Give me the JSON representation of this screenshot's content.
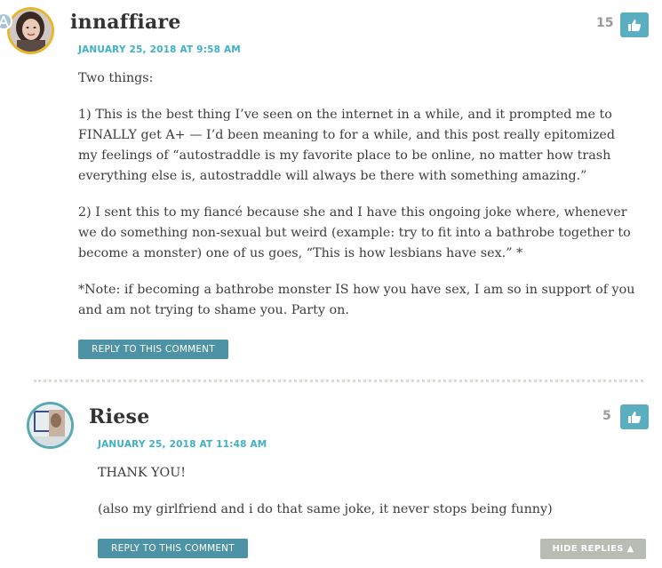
{
  "comments": [
    {
      "author": "innaffiare",
      "date": "JANUARY 25, 2018 AT 9:58 AM",
      "likes": "15",
      "paragraphs": {
        "p0": "Two things:",
        "p1": "1) This is the best thing I’ve seen on the internet in a while, and it prompted me to FINALLY get A+ — I’d been meaning to for a while, and this post really epitomized my feelings of “autostraddle is my favorite place to be online, no matter how trash everything else is, autostraddle will always be there with something amazing.”",
        "p2": "2) I sent this to my fiancé because she and I have this ongoing joke where, whenever we do something non-sexual but weird (example: try to fit into a bathrobe together to become a monster) one of us goes, “This is how lesbians have sex.” *",
        "p3": "*Note: if becoming a bathrobe monster IS how you have sex, I am so in support of you and am not trying to shame you. Party on."
      },
      "reply_label": "REPLY TO THIS COMMENT",
      "avatar_icon": "user-avatar-photo",
      "badge_icon": "a-plus-member-badge-icon",
      "avatar_border_color": "#e7b62f"
    },
    {
      "author": "Riese",
      "date": "JANUARY 25, 2018 AT 11:48 AM",
      "likes": "5",
      "paragraphs": {
        "p0": "THANK YOU!",
        "p1": "(also my girlfriend and i do that same joke, it never stops being funny)"
      },
      "reply_label": "REPLY TO THIS COMMENT",
      "avatar_icon": "user-avatar-photo",
      "avatar_border_color": "#5aa9b5"
    }
  ],
  "hide_replies_label": "HIDE REPLIES ▲",
  "like_icon": "thumbs-up-icon",
  "colors": {
    "accent": "#3eb0c6",
    "like_button": "#5badc0",
    "reply_button": "#4e93a5",
    "hide_button": "#b7bdb3"
  }
}
